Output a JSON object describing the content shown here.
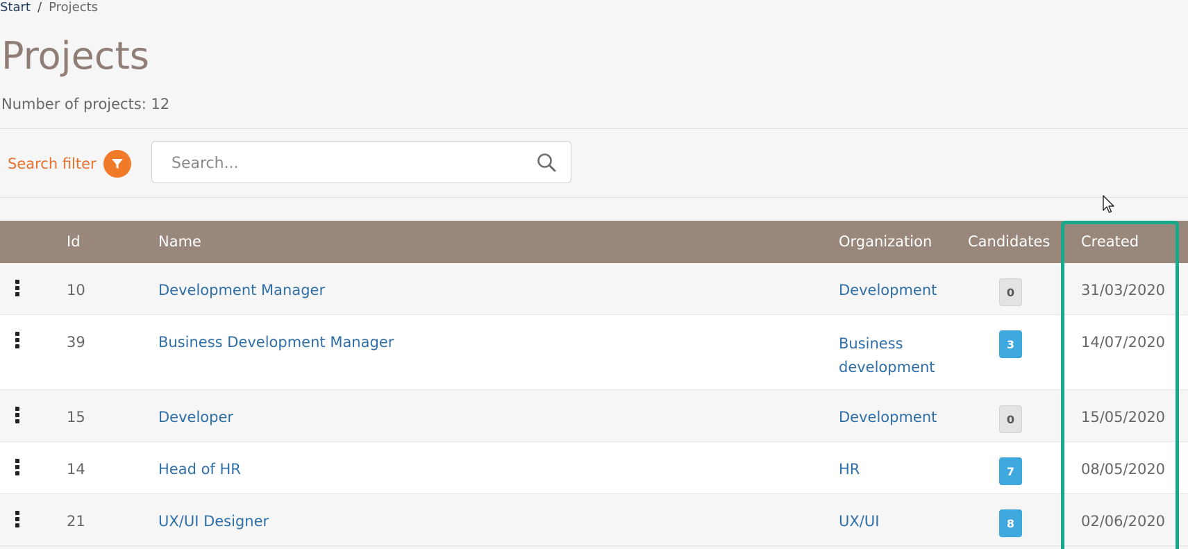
{
  "breadcrumb": {
    "home": "Start",
    "separator": "/",
    "current": "Projects"
  },
  "page": {
    "title": "Projects",
    "count_label": "Number of projects: 12"
  },
  "filter": {
    "label": "Search filter",
    "icon": "filter-icon",
    "accent_color": "#f07a28"
  },
  "search": {
    "placeholder": "Search...",
    "value": "",
    "icon": "search-icon"
  },
  "table": {
    "header_color": "#9a877b",
    "columns": {
      "id": "Id",
      "name": "Name",
      "organization": "Organization",
      "candidates": "Candidates",
      "created": "Created"
    },
    "rows": [
      {
        "id": "10",
        "name": "Development Manager",
        "organization": "Development",
        "candidates": "0",
        "created": "31/03/2020"
      },
      {
        "id": "39",
        "name": "Business Development Manager",
        "organization": "Business development",
        "candidates": "3",
        "created": "14/07/2020"
      },
      {
        "id": "15",
        "name": "Developer",
        "organization": "Development",
        "candidates": "0",
        "created": "15/05/2020"
      },
      {
        "id": "14",
        "name": "Head of HR",
        "organization": "HR",
        "candidates": "7",
        "created": "08/05/2020"
      },
      {
        "id": "21",
        "name": "UX/UI Designer",
        "organization": "UX/UI",
        "candidates": "8",
        "created": "02/06/2020"
      }
    ]
  },
  "highlight": {
    "color": "#17a98a"
  }
}
